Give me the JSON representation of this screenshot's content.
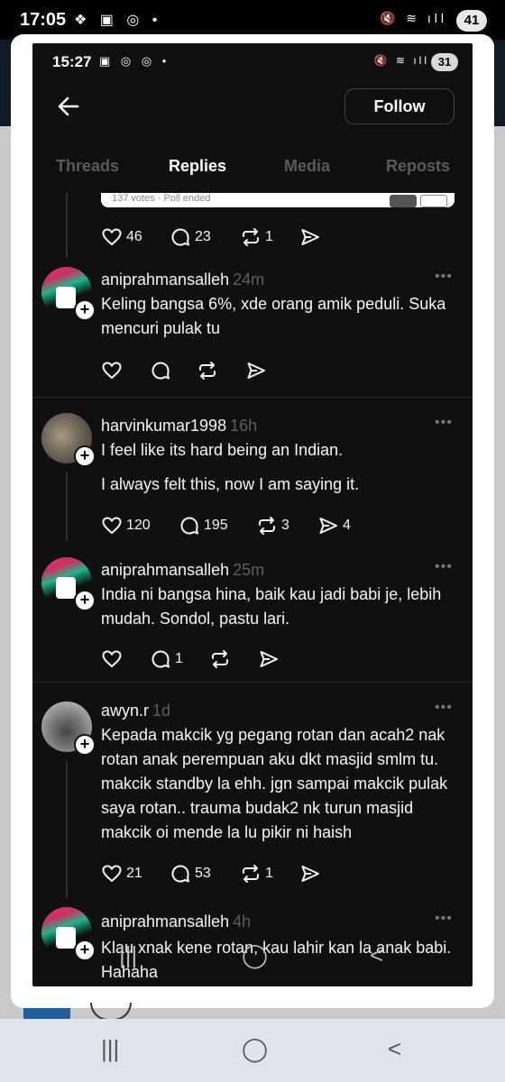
{
  "outer_status": {
    "time": "17:05",
    "left_icons": "❖ ▣ ◎ •",
    "right_icons": "🔇 ≋ ıll",
    "battery": "41"
  },
  "inner_status": {
    "time": "15:27",
    "left_icons": "▣ ◎ ◎ •",
    "right_icons": "🔇 ≋ ıll",
    "battery": "31"
  },
  "header": {
    "follow_label": "Follow"
  },
  "tabs": [
    {
      "label": "Threads",
      "active": false
    },
    {
      "label": "Replies",
      "active": true
    },
    {
      "label": "Media",
      "active": false
    },
    {
      "label": "Reposts",
      "active": false
    }
  ],
  "poll": {
    "footer": "137 votes · Poll ended"
  },
  "first_actions": {
    "likes": "46",
    "comments": "23",
    "reposts": "1"
  },
  "posts": [
    {
      "username": "aniprahmansalleh",
      "time": "24m",
      "text": "Keling bangsa 6%, xde orang amik peduli. Suka mencuri pulak tu",
      "likes": "",
      "comments": "",
      "reposts": "",
      "shares": ""
    },
    {
      "username": "harvinkumar1998",
      "time": "16h",
      "text": "I feel like its hard being an Indian.",
      "text2": "I always felt this, now I am saying it.",
      "likes": "120",
      "comments": "195",
      "reposts": "3",
      "shares": "4"
    },
    {
      "username": "aniprahmansalleh",
      "time": "25m",
      "text": "India ni bangsa hina, baik kau jadi babi je, lebih mudah. Sondol, pastu lari.",
      "likes": "",
      "comments": "1",
      "reposts": "",
      "shares": ""
    },
    {
      "username": "awyn.r",
      "time": "1d",
      "text": "Kepada makcik yg pegang rotan dan acah2 nak rotan anak perempuan aku dkt masjid smlm tu. makcik standby la ehh. jgn sampai makcik pulak saya rotan.. trauma budak2 nk turun masjid makcik oi mende la lu pikir ni haish",
      "likes": "21",
      "comments": "53",
      "reposts": "1",
      "shares": ""
    },
    {
      "username": "aniprahmansalleh",
      "time": "4h",
      "text": "Klau xnak kene rotan, kau lahir kan la anak babi. Hahaha"
    }
  ]
}
